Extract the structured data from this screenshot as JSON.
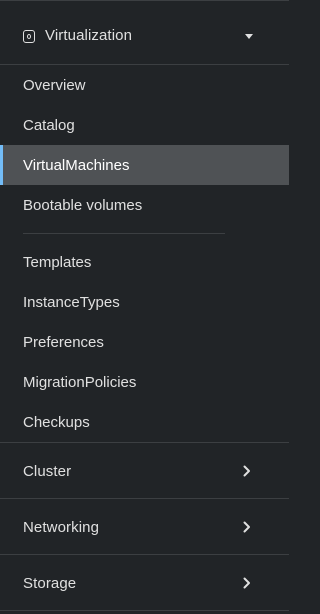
{
  "nav": {
    "virtualization": {
      "label": "Virtualization",
      "icon": "virtualization-icon",
      "expanded": true,
      "group1": [
        {
          "label": "Overview",
          "active": false
        },
        {
          "label": "Catalog",
          "active": false
        },
        {
          "label": "VirtualMachines",
          "active": true
        },
        {
          "label": "Bootable volumes",
          "active": false
        }
      ],
      "group2": [
        {
          "label": "Templates",
          "active": false
        },
        {
          "label": "InstanceTypes",
          "active": false
        },
        {
          "label": "Preferences",
          "active": false
        },
        {
          "label": "MigrationPolicies",
          "active": false
        },
        {
          "label": "Checkups",
          "active": false
        }
      ]
    },
    "sections": [
      {
        "label": "Cluster",
        "expanded": false
      },
      {
        "label": "Networking",
        "expanded": false
      },
      {
        "label": "Storage",
        "expanded": false
      }
    ]
  },
  "colors": {
    "background": "#212427",
    "active_background": "#4f5255",
    "active_indicator": "#73bcf7",
    "text": "#e0e0e0",
    "divider": "#3c3f42"
  }
}
